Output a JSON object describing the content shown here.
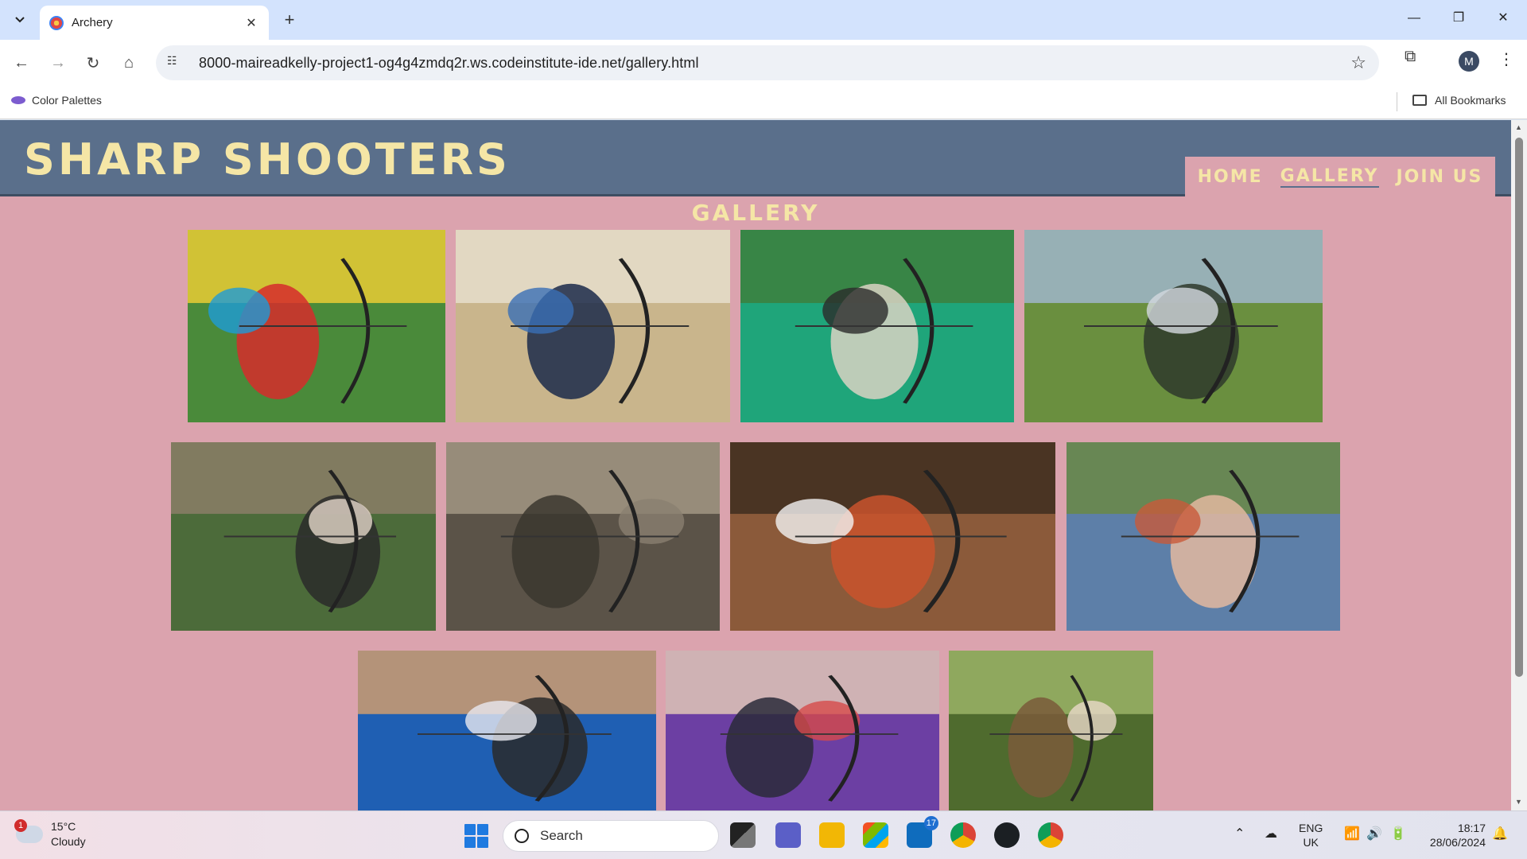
{
  "browser": {
    "tab_title": "Archery",
    "url": "8000-maireadkelly-project1-og4g4zmdq2r.ws.codeinstitute-ide.net/gallery.html",
    "bookmark_item": "Color Palettes",
    "all_bookmarks": "All Bookmarks",
    "profile_initial": "M"
  },
  "site": {
    "logo": "SHARP SHOOTERS",
    "nav": [
      {
        "label": "HOME",
        "active": false
      },
      {
        "label": "GALLERY",
        "active": true
      },
      {
        "label": "JOIN US",
        "active": false
      }
    ],
    "page_heading": "GALLERY",
    "photos": [
      {
        "name": "targets-with-arrows-photo",
        "palette": [
          "#4a8a3a",
          "#1e9bd7",
          "#d62b2b",
          "#f2d035"
        ]
      },
      {
        "name": "kids-indoor-archery-photo",
        "palette": [
          "#c9b58c",
          "#3a6fb5",
          "#1b2a4a",
          "#e9e1d0"
        ]
      },
      {
        "name": "indoor-range-green-floor-photo",
        "palette": [
          "#1fa57a",
          "#2b2b2b",
          "#d9d2c3",
          "#3f7d3a"
        ]
      },
      {
        "name": "field-archery-line-photo",
        "palette": [
          "#6a8f3f",
          "#d3d8df",
          "#2e3a2b",
          "#a2b8d3"
        ]
      },
      {
        "name": "coach-and-girl-archery-photo",
        "palette": [
          "#4c6b3a",
          "#e4d7c9",
          "#2a2a2a",
          "#8f7f6a"
        ]
      },
      {
        "name": "camouflage-bowhunter-photo",
        "palette": [
          "#5b5348",
          "#8a8070",
          "#3b372f",
          "#a69b87"
        ]
      },
      {
        "name": "red-haired-archer-photo",
        "palette": [
          "#8b5a3a",
          "#f2f2f2",
          "#c9542d",
          "#3a2a1e"
        ]
      },
      {
        "name": "women-outdoor-archery-photo",
        "palette": [
          "#5d7fa8",
          "#c85a3a",
          "#e3b9a0",
          "#6b8a3e"
        ]
      },
      {
        "name": "competition-archer-blue-photo",
        "palette": [
          "#1f5fb3",
          "#e8e8f0",
          "#2a2a2a",
          "#d9a06a"
        ]
      },
      {
        "name": "compound-archer-crowd-photo",
        "palette": [
          "#6c3fa3",
          "#d64a4a",
          "#2a2a3a",
          "#e8d0b8"
        ]
      },
      {
        "name": "woman-longbow-forest-photo",
        "palette": [
          "#4f6b2e",
          "#e8d8c8",
          "#7a5a3a",
          "#9fb86a"
        ]
      }
    ]
  },
  "taskbar": {
    "weather_badge": "1",
    "temperature": "15°C",
    "condition": "Cloudy",
    "search_label": "Search",
    "mail_badge": "17",
    "lang_line1": "ENG",
    "lang_line2": "UK",
    "time": "18:17",
    "date": "28/06/2024"
  }
}
